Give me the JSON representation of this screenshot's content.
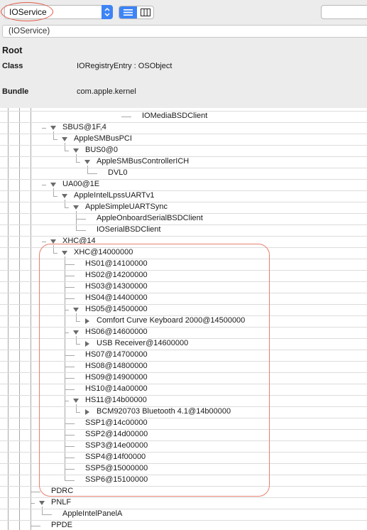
{
  "toolbar": {
    "plane": "IOService",
    "view_modes": [
      "list-view-icon",
      "column-view-icon"
    ],
    "search_placeholder": ""
  },
  "path": "(IOService)",
  "info": {
    "title": "Root",
    "rows": [
      {
        "label": "Class",
        "value": "IORegistryEntry : OSObject"
      },
      {
        "label": "Bundle",
        "value": "com.apple.kernel"
      }
    ]
  },
  "tree": [
    {
      "label": "IOMediaBSDClient",
      "depth": 11,
      "expand": "leaf"
    },
    {
      "label": "SBUS@1F,4",
      "depth": 4,
      "expand": "open"
    },
    {
      "label": "AppleSMBusPCI",
      "depth": 5,
      "expand": "open"
    },
    {
      "label": "BUS0@0",
      "depth": 6,
      "expand": "open"
    },
    {
      "label": "AppleSMBusControllerICH",
      "depth": 7,
      "expand": "open"
    },
    {
      "label": "DVL0",
      "depth": 8,
      "expand": "leaf"
    },
    {
      "label": "UA00@1E",
      "depth": 4,
      "expand": "open"
    },
    {
      "label": "AppleIntelLpssUARTv1",
      "depth": 5,
      "expand": "open"
    },
    {
      "label": "AppleSimpleUARTSync",
      "depth": 6,
      "expand": "open"
    },
    {
      "label": "AppleOnboardSerialBSDClient",
      "depth": 7,
      "expand": "leaf"
    },
    {
      "label": "IOSerialBSDClient",
      "depth": 7,
      "expand": "leaf"
    },
    {
      "label": "XHC@14",
      "depth": 4,
      "expand": "open"
    },
    {
      "label": "XHC@14000000",
      "depth": 5,
      "expand": "open"
    },
    {
      "label": "HS01@14100000",
      "depth": 6,
      "expand": "leaf"
    },
    {
      "label": "HS02@14200000",
      "depth": 6,
      "expand": "leaf"
    },
    {
      "label": "HS03@14300000",
      "depth": 6,
      "expand": "leaf"
    },
    {
      "label": "HS04@14400000",
      "depth": 6,
      "expand": "leaf"
    },
    {
      "label": "HS05@14500000",
      "depth": 6,
      "expand": "open"
    },
    {
      "label": "Comfort Curve Keyboard 2000@14500000",
      "depth": 7,
      "expand": "closed"
    },
    {
      "label": "HS06@14600000",
      "depth": 6,
      "expand": "open"
    },
    {
      "label": "USB Receiver@14600000",
      "depth": 7,
      "expand": "closed"
    },
    {
      "label": "HS07@14700000",
      "depth": 6,
      "expand": "leaf"
    },
    {
      "label": "HS08@14800000",
      "depth": 6,
      "expand": "leaf"
    },
    {
      "label": "HS09@14900000",
      "depth": 6,
      "expand": "leaf"
    },
    {
      "label": "HS10@14a00000",
      "depth": 6,
      "expand": "leaf"
    },
    {
      "label": "HS11@14b00000",
      "depth": 6,
      "expand": "open"
    },
    {
      "label": "BCM920703 Bluetooth 4.1@14b00000",
      "depth": 7,
      "expand": "closed"
    },
    {
      "label": "SSP1@14c00000",
      "depth": 6,
      "expand": "leaf"
    },
    {
      "label": "SSP2@14d00000",
      "depth": 6,
      "expand": "leaf"
    },
    {
      "label": "SSP3@14e00000",
      "depth": 6,
      "expand": "leaf"
    },
    {
      "label": "SSP4@14f00000",
      "depth": 6,
      "expand": "leaf"
    },
    {
      "label": "SSP5@15000000",
      "depth": 6,
      "expand": "leaf"
    },
    {
      "label": "SSP6@15100000",
      "depth": 6,
      "expand": "leaf"
    },
    {
      "label": "PDRC",
      "depth": 3,
      "expand": "leaf"
    },
    {
      "label": "PNLF",
      "depth": 3,
      "expand": "open"
    },
    {
      "label": "AppleIntelPanelA",
      "depth": 4,
      "expand": "leaf"
    },
    {
      "label": "PPDE",
      "depth": 3,
      "expand": "leaf"
    }
  ]
}
